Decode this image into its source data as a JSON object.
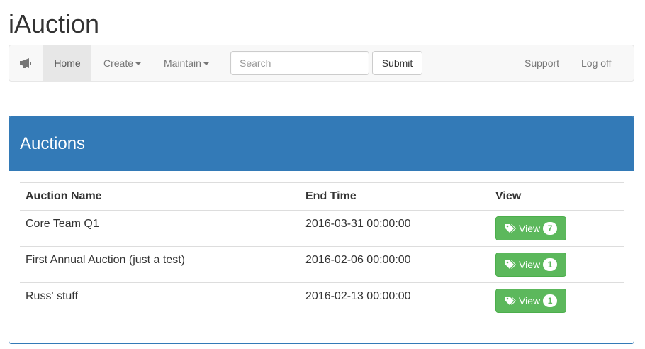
{
  "app": {
    "title": "iAuction"
  },
  "navbar": {
    "brand_icon": "megaphone-icon",
    "home_label": "Home",
    "create_label": "Create",
    "maintain_label": "Maintain",
    "search_placeholder": "Search",
    "search_value": "",
    "submit_label": "Submit",
    "support_label": "Support",
    "logoff_label": "Log off"
  },
  "panel": {
    "title": "Auctions",
    "columns": [
      "Auction Name",
      "End Time",
      "View"
    ],
    "rows": [
      {
        "name": "Core Team Q1",
        "end_time": "2016-03-31 00:00:00",
        "view_label": "View",
        "count": "7"
      },
      {
        "name": "First Annual Auction (just a test)",
        "end_time": "2016-02-06 00:00:00",
        "view_label": "View",
        "count": "1"
      },
      {
        "name": "Russ' stuff",
        "end_time": "2016-02-13 00:00:00",
        "view_label": "View",
        "count": "1"
      }
    ]
  },
  "colors": {
    "primary": "#337ab7",
    "success": "#5cb85c",
    "navbar_bg": "#f8f8f8"
  }
}
